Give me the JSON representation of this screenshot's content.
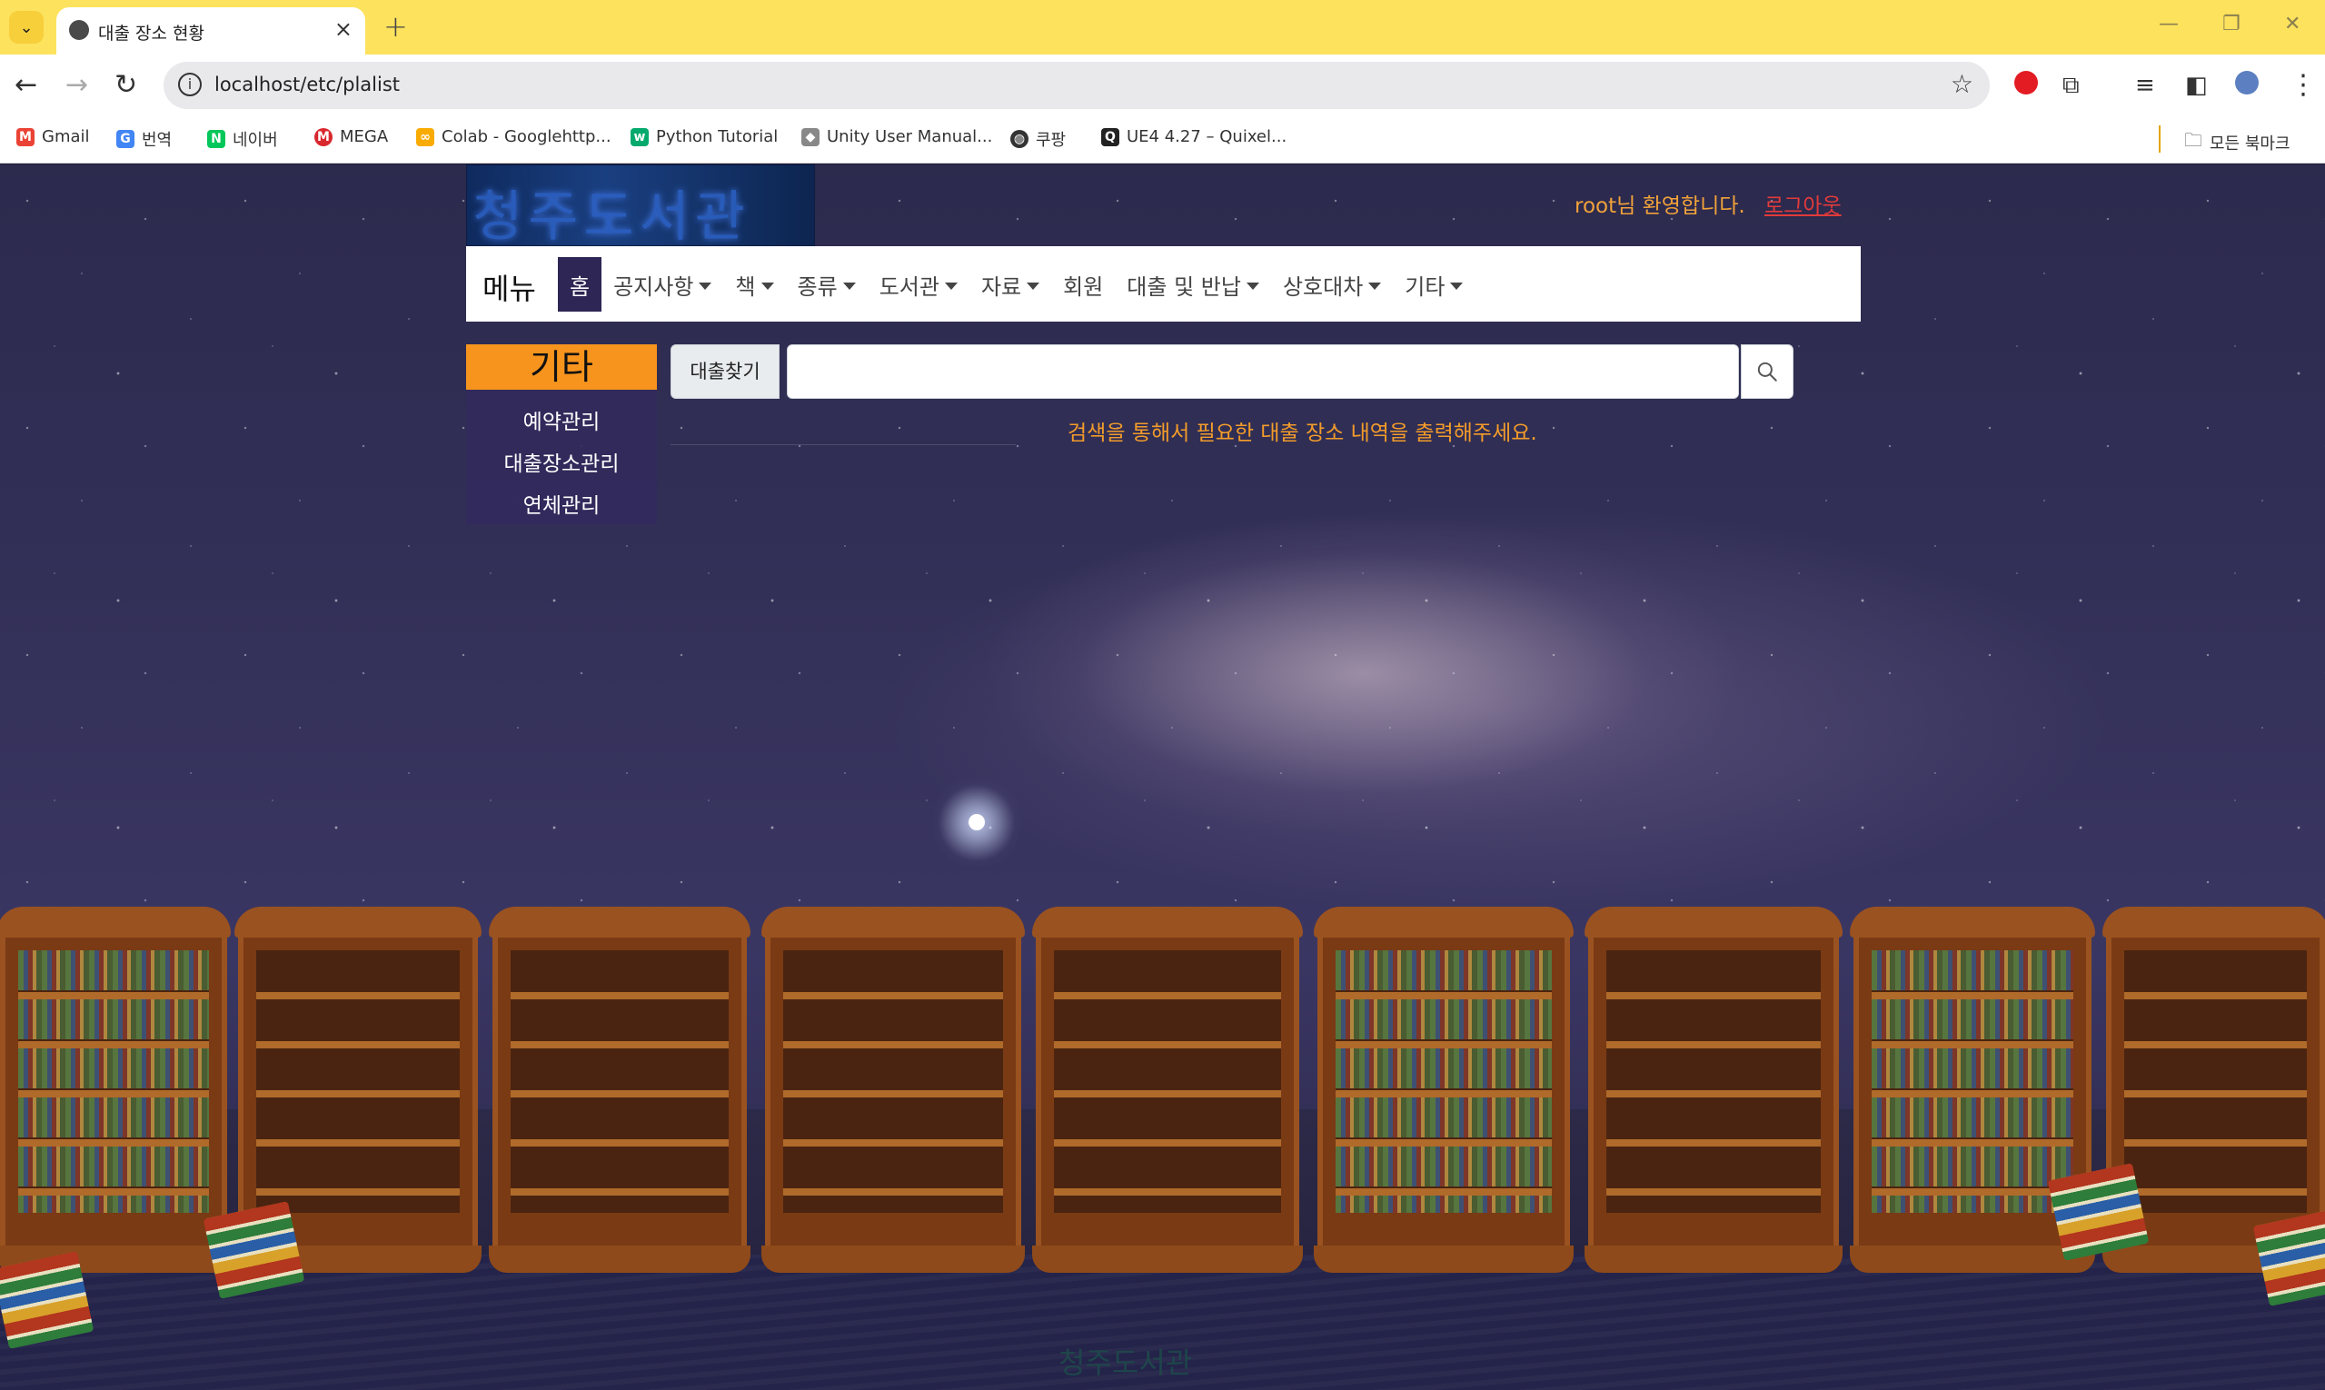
{
  "browser": {
    "tab_title": "대출 장소 현황",
    "url": "localhost/etc/plalist",
    "bookmarks": [
      {
        "label": "Gmail",
        "icon": "gmail-icon",
        "color": "#ea4335"
      },
      {
        "label": "번역",
        "icon": "translate-icon",
        "color": "#4285f4"
      },
      {
        "label": "네이버",
        "icon": "naver-icon",
        "color": "#03c75a"
      },
      {
        "label": "MEGA",
        "icon": "mega-icon",
        "color": "#d9272e"
      },
      {
        "label": "Colab - Googlehttp...",
        "icon": "colab-icon",
        "color": "#f9ab00"
      },
      {
        "label": "Python Tutorial",
        "icon": "w3schools-icon",
        "color": "#04aa6d"
      },
      {
        "label": "Unity User Manual...",
        "icon": "unity-icon",
        "color": "#888888"
      },
      {
        "label": "쿠팡",
        "icon": "globe-icon",
        "color": "#333333"
      },
      {
        "label": "UE4 4.27 – Quixel...",
        "icon": "quixel-icon",
        "color": "#222222"
      }
    ],
    "all_bookmarks": "모든 북마크"
  },
  "site": {
    "logo_text": "청주도서관",
    "welcome": "root님 환영합니다.",
    "logout": "로그아웃",
    "brand": "메뉴",
    "nav": [
      {
        "label": "홈",
        "dropdown": false,
        "active": true
      },
      {
        "label": "공지사항",
        "dropdown": true
      },
      {
        "label": "책",
        "dropdown": true
      },
      {
        "label": "종류",
        "dropdown": true
      },
      {
        "label": "도서관",
        "dropdown": true
      },
      {
        "label": "자료",
        "dropdown": true
      },
      {
        "label": "회원",
        "dropdown": false
      },
      {
        "label": "대출 및 반납",
        "dropdown": true
      },
      {
        "label": "상호대차",
        "dropdown": true
      },
      {
        "label": "기타",
        "dropdown": true
      }
    ],
    "side_title": "기타",
    "side_items": [
      "예약관리",
      "대출장소관리",
      "연체관리"
    ],
    "search_label": "대출찾기",
    "search_value": "",
    "hint": "검색을 통해서 필요한 대출 장소 내역을 출력해주세요.",
    "footer_logo": "청주도서관"
  },
  "colors": {
    "tabbar": "#fde25d",
    "accent_orange": "#f7941d",
    "active_nav": "#2e2654",
    "logout_red": "#e33a3a"
  }
}
